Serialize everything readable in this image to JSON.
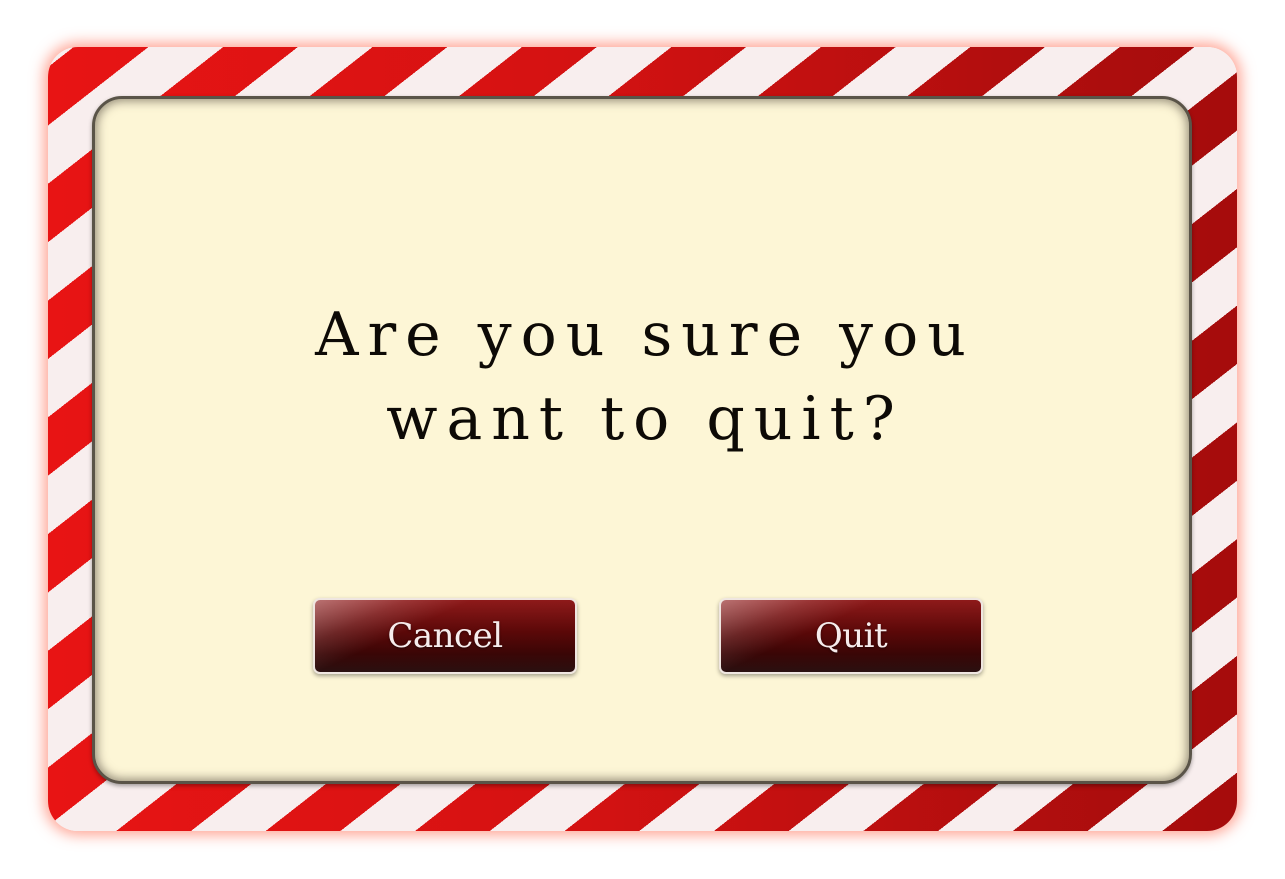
{
  "dialog": {
    "prompt_line1": "Are you sure you",
    "prompt_line2": "want to quit?",
    "cancel_label": "Cancel",
    "quit_label": "Quit"
  },
  "colors": {
    "frame_red": "#d41212",
    "frame_stripe": "#f8eeee",
    "panel_background": "#fdf6d6",
    "button_dark_red": "#5a0808",
    "text_dark": "#0d0a06",
    "button_text": "#f6ecec"
  }
}
